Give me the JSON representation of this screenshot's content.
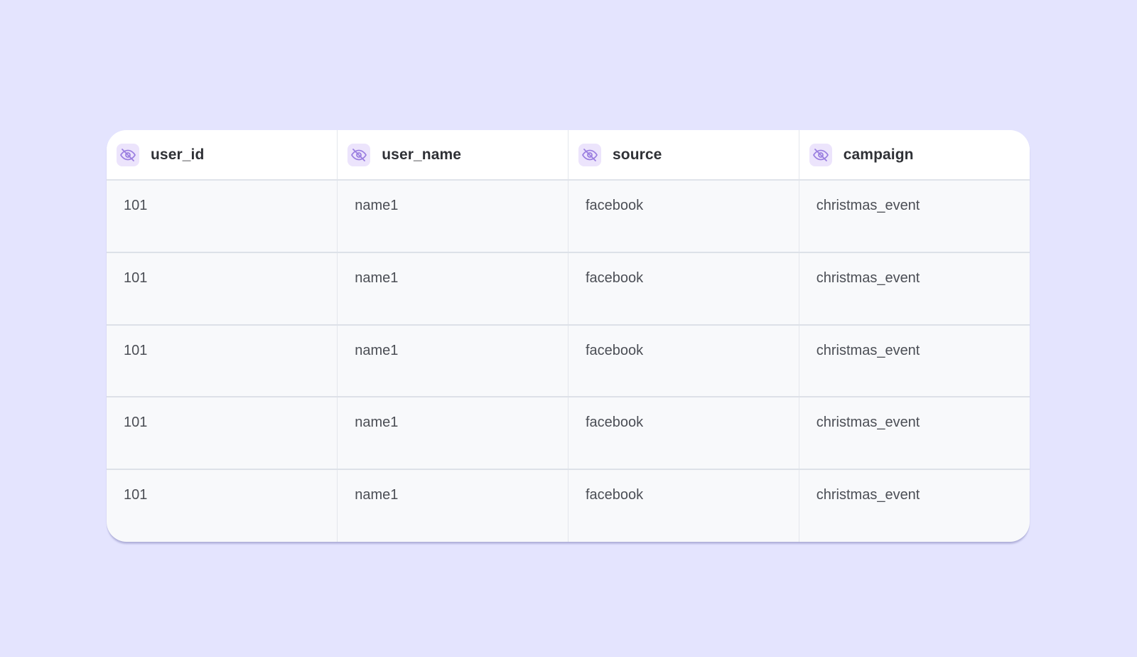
{
  "table": {
    "columns": [
      {
        "label": "user_id",
        "icon": "eye-off-icon"
      },
      {
        "label": "user_name",
        "icon": "eye-off-icon"
      },
      {
        "label": "source",
        "icon": "eye-off-icon"
      },
      {
        "label": "campaign",
        "icon": "eye-off-icon"
      }
    ],
    "rows": [
      [
        "101",
        "name1",
        "facebook",
        "christmas_event"
      ],
      [
        "101",
        "name1",
        "facebook",
        "christmas_event"
      ],
      [
        "101",
        "name1",
        "facebook",
        "christmas_event"
      ],
      [
        "101",
        "name1",
        "facebook",
        "christmas_event"
      ],
      [
        "101",
        "name1",
        "facebook",
        "christmas_event"
      ]
    ]
  },
  "colors": {
    "background": "#e4e4fe",
    "icon_accent": "#9b7fe0",
    "icon_badge": "#ece4fc"
  }
}
